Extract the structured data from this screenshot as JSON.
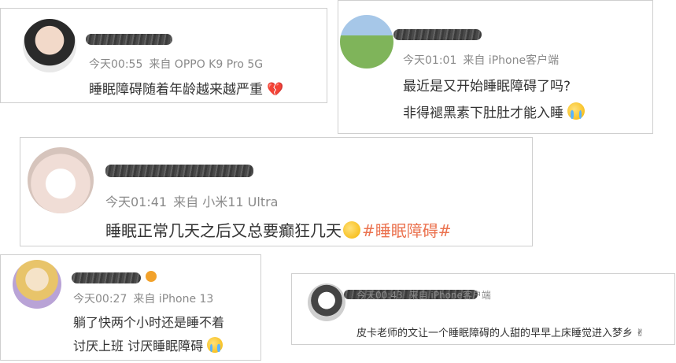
{
  "posts": [
    {
      "meta_time": "今天00:55",
      "meta_source": "来自 OPPO K9 Pro 5G",
      "lines": [
        "睡眠障碍随着年龄越来越严重"
      ],
      "trailing_emoji": "broken-heart"
    },
    {
      "meta_time": "今天01:01",
      "meta_source": "来自 iPhone客户端",
      "lines": [
        "最近是又开始睡眠障碍了吗?",
        "非得褪黑素下肚肚才能入睡"
      ],
      "trailing_emoji": "crying-face"
    },
    {
      "meta_time": "今天01:41",
      "meta_source": "来自 小米11 Ultra",
      "lines": [
        "睡眠正常几天之后又总要癫狂几天"
      ],
      "trailing_emoji": "upside-down-face",
      "hashtag": "#睡眠障碍#"
    },
    {
      "meta_time": "今天00:27",
      "meta_source": "来自 iPhone 13",
      "lines": [
        "躺了快两个小时还是睡不着",
        "讨厌上班 讨厌睡眠障碍"
      ],
      "trailing_emoji": "crying-face"
    },
    {
      "meta_time": "今天00:43",
      "meta_source": "来自 iPhone客户端",
      "lines": [
        "皮卡老师的文让一个睡眠障碍的人甜的早早上床睡觉进入梦乡"
      ],
      "trailing_emoji": "victory-hand"
    }
  ],
  "colors": {
    "hashtag": "#eb7350",
    "meta": "#8a8a8a",
    "text": "#333333"
  }
}
